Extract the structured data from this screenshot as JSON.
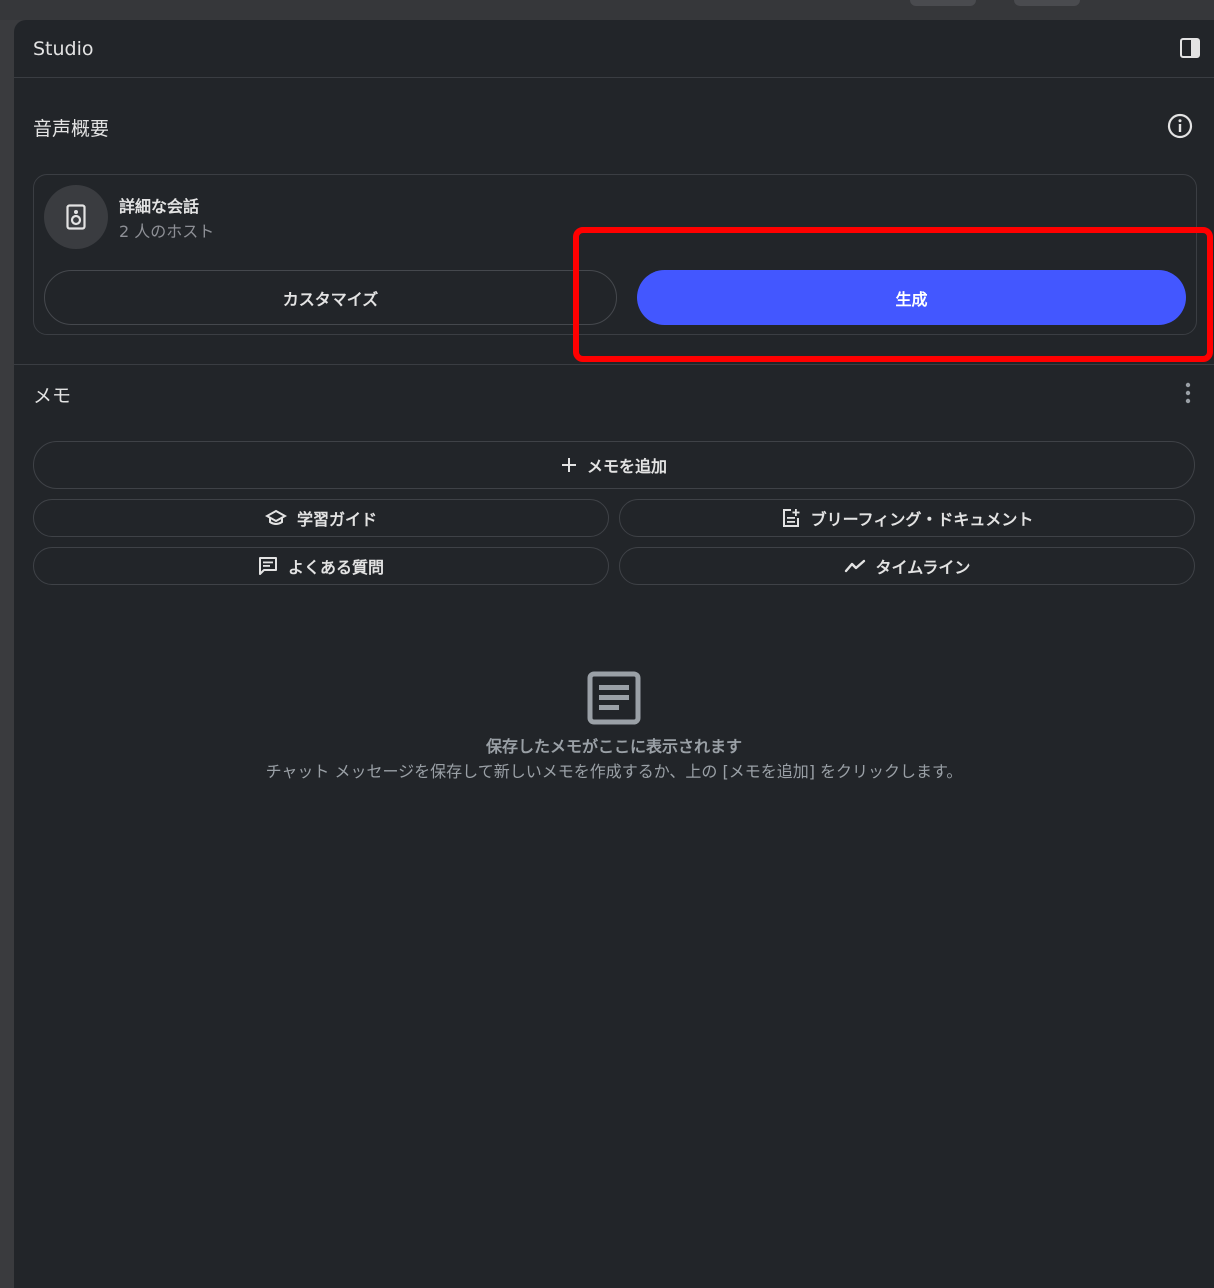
{
  "panel": {
    "title": "Studio"
  },
  "audio_overview": {
    "section_title": "音声概要",
    "card_title": "詳細な会話",
    "card_subtitle": "2 人のホスト",
    "customize_label": "カスタマイズ",
    "generate_label": "生成"
  },
  "notes": {
    "section_title": "メモ",
    "add_note_label": "メモを追加",
    "study_guide_label": "学習ガイド",
    "briefing_doc_label": "ブリーフィング・ドキュメント",
    "faq_label": "よくある質問",
    "timeline_label": "タイムライン",
    "empty_title": "保存したメモがここに表示されます",
    "empty_subtitle": "チャット メッセージを保存して新しいメモを作成するか、上の [メモを追加] をクリックします。"
  },
  "colors": {
    "panel_bg": "#222529",
    "primary_button": "#4357ff",
    "highlight": "#ff0000"
  }
}
